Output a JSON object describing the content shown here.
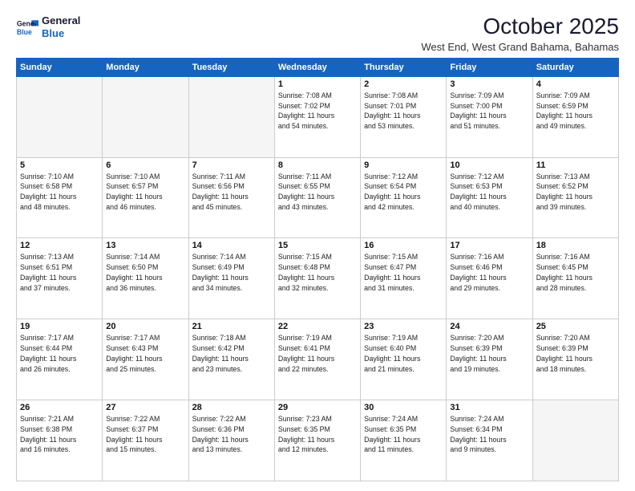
{
  "header": {
    "logo_general": "General",
    "logo_blue": "Blue",
    "month_title": "October 2025",
    "location": "West End, West Grand Bahama, Bahamas"
  },
  "weekdays": [
    "Sunday",
    "Monday",
    "Tuesday",
    "Wednesday",
    "Thursday",
    "Friday",
    "Saturday"
  ],
  "weeks": [
    [
      {
        "day": "",
        "info": ""
      },
      {
        "day": "",
        "info": ""
      },
      {
        "day": "",
        "info": ""
      },
      {
        "day": "1",
        "info": "Sunrise: 7:08 AM\nSunset: 7:02 PM\nDaylight: 11 hours\nand 54 minutes."
      },
      {
        "day": "2",
        "info": "Sunrise: 7:08 AM\nSunset: 7:01 PM\nDaylight: 11 hours\nand 53 minutes."
      },
      {
        "day": "3",
        "info": "Sunrise: 7:09 AM\nSunset: 7:00 PM\nDaylight: 11 hours\nand 51 minutes."
      },
      {
        "day": "4",
        "info": "Sunrise: 7:09 AM\nSunset: 6:59 PM\nDaylight: 11 hours\nand 49 minutes."
      }
    ],
    [
      {
        "day": "5",
        "info": "Sunrise: 7:10 AM\nSunset: 6:58 PM\nDaylight: 11 hours\nand 48 minutes."
      },
      {
        "day": "6",
        "info": "Sunrise: 7:10 AM\nSunset: 6:57 PM\nDaylight: 11 hours\nand 46 minutes."
      },
      {
        "day": "7",
        "info": "Sunrise: 7:11 AM\nSunset: 6:56 PM\nDaylight: 11 hours\nand 45 minutes."
      },
      {
        "day": "8",
        "info": "Sunrise: 7:11 AM\nSunset: 6:55 PM\nDaylight: 11 hours\nand 43 minutes."
      },
      {
        "day": "9",
        "info": "Sunrise: 7:12 AM\nSunset: 6:54 PM\nDaylight: 11 hours\nand 42 minutes."
      },
      {
        "day": "10",
        "info": "Sunrise: 7:12 AM\nSunset: 6:53 PM\nDaylight: 11 hours\nand 40 minutes."
      },
      {
        "day": "11",
        "info": "Sunrise: 7:13 AM\nSunset: 6:52 PM\nDaylight: 11 hours\nand 39 minutes."
      }
    ],
    [
      {
        "day": "12",
        "info": "Sunrise: 7:13 AM\nSunset: 6:51 PM\nDaylight: 11 hours\nand 37 minutes."
      },
      {
        "day": "13",
        "info": "Sunrise: 7:14 AM\nSunset: 6:50 PM\nDaylight: 11 hours\nand 36 minutes."
      },
      {
        "day": "14",
        "info": "Sunrise: 7:14 AM\nSunset: 6:49 PM\nDaylight: 11 hours\nand 34 minutes."
      },
      {
        "day": "15",
        "info": "Sunrise: 7:15 AM\nSunset: 6:48 PM\nDaylight: 11 hours\nand 32 minutes."
      },
      {
        "day": "16",
        "info": "Sunrise: 7:15 AM\nSunset: 6:47 PM\nDaylight: 11 hours\nand 31 minutes."
      },
      {
        "day": "17",
        "info": "Sunrise: 7:16 AM\nSunset: 6:46 PM\nDaylight: 11 hours\nand 29 minutes."
      },
      {
        "day": "18",
        "info": "Sunrise: 7:16 AM\nSunset: 6:45 PM\nDaylight: 11 hours\nand 28 minutes."
      }
    ],
    [
      {
        "day": "19",
        "info": "Sunrise: 7:17 AM\nSunset: 6:44 PM\nDaylight: 11 hours\nand 26 minutes."
      },
      {
        "day": "20",
        "info": "Sunrise: 7:17 AM\nSunset: 6:43 PM\nDaylight: 11 hours\nand 25 minutes."
      },
      {
        "day": "21",
        "info": "Sunrise: 7:18 AM\nSunset: 6:42 PM\nDaylight: 11 hours\nand 23 minutes."
      },
      {
        "day": "22",
        "info": "Sunrise: 7:19 AM\nSunset: 6:41 PM\nDaylight: 11 hours\nand 22 minutes."
      },
      {
        "day": "23",
        "info": "Sunrise: 7:19 AM\nSunset: 6:40 PM\nDaylight: 11 hours\nand 21 minutes."
      },
      {
        "day": "24",
        "info": "Sunrise: 7:20 AM\nSunset: 6:39 PM\nDaylight: 11 hours\nand 19 minutes."
      },
      {
        "day": "25",
        "info": "Sunrise: 7:20 AM\nSunset: 6:39 PM\nDaylight: 11 hours\nand 18 minutes."
      }
    ],
    [
      {
        "day": "26",
        "info": "Sunrise: 7:21 AM\nSunset: 6:38 PM\nDaylight: 11 hours\nand 16 minutes."
      },
      {
        "day": "27",
        "info": "Sunrise: 7:22 AM\nSunset: 6:37 PM\nDaylight: 11 hours\nand 15 minutes."
      },
      {
        "day": "28",
        "info": "Sunrise: 7:22 AM\nSunset: 6:36 PM\nDaylight: 11 hours\nand 13 minutes."
      },
      {
        "day": "29",
        "info": "Sunrise: 7:23 AM\nSunset: 6:35 PM\nDaylight: 11 hours\nand 12 minutes."
      },
      {
        "day": "30",
        "info": "Sunrise: 7:24 AM\nSunset: 6:35 PM\nDaylight: 11 hours\nand 11 minutes."
      },
      {
        "day": "31",
        "info": "Sunrise: 7:24 AM\nSunset: 6:34 PM\nDaylight: 11 hours\nand 9 minutes."
      },
      {
        "day": "",
        "info": ""
      }
    ]
  ]
}
